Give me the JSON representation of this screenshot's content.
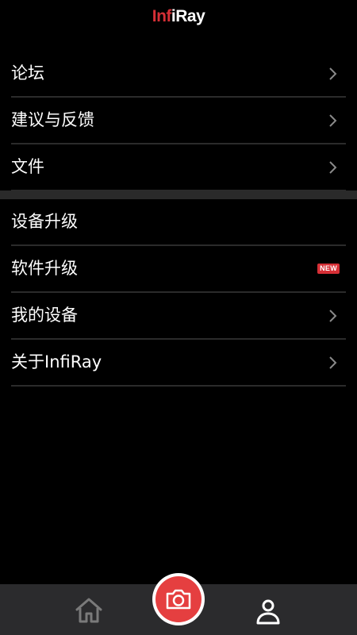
{
  "header": {
    "logo_part1": "Inf",
    "logo_part2": "iRay"
  },
  "menu_group_1": [
    {
      "label": "论坛",
      "icon": "chevron-right-icon"
    },
    {
      "label": "建议与反馈",
      "icon": "chevron-right-icon"
    },
    {
      "label": "文件",
      "icon": "chevron-right-icon"
    }
  ],
  "menu_group_2": [
    {
      "label": "设备升级"
    },
    {
      "label": "软件升级",
      "badge": "NEW"
    },
    {
      "label": "我的设备",
      "icon": "chevron-right-icon"
    },
    {
      "label": "关于InfiRay",
      "icon": "chevron-right-icon"
    }
  ],
  "bottom_nav": {
    "home_icon": "home-icon",
    "camera_icon": "camera-icon",
    "profile_icon": "profile-icon"
  },
  "colors": {
    "accent": "#d62f36",
    "camera": "#e53f40",
    "background": "#000000",
    "bar": "#2b2b2d"
  }
}
